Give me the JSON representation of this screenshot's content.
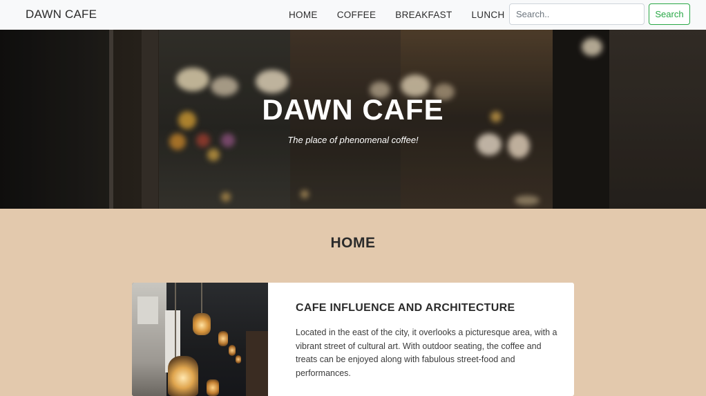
{
  "navbar": {
    "brand": "DAWN CAFE",
    "links": [
      "HOME",
      "COFFEE",
      "BREAKFAST",
      "LUNCH"
    ],
    "search_placeholder": "Search..",
    "search_button": "Search",
    "accent_color": "#28a745"
  },
  "hero": {
    "title": "DAWN CAFE",
    "subtitle": "The place of phenomenal coffee!"
  },
  "main": {
    "section_title": "HOME",
    "card": {
      "title": "CAFE INFLUENCE AND ARCHITECTURE",
      "text": "Located in the east of the city, it overlooks a picturesque area, with a vibrant street of cultural art. With outdoor seating, the coffee and treats can be enjoyed along with fabulous street-food and performances."
    }
  }
}
